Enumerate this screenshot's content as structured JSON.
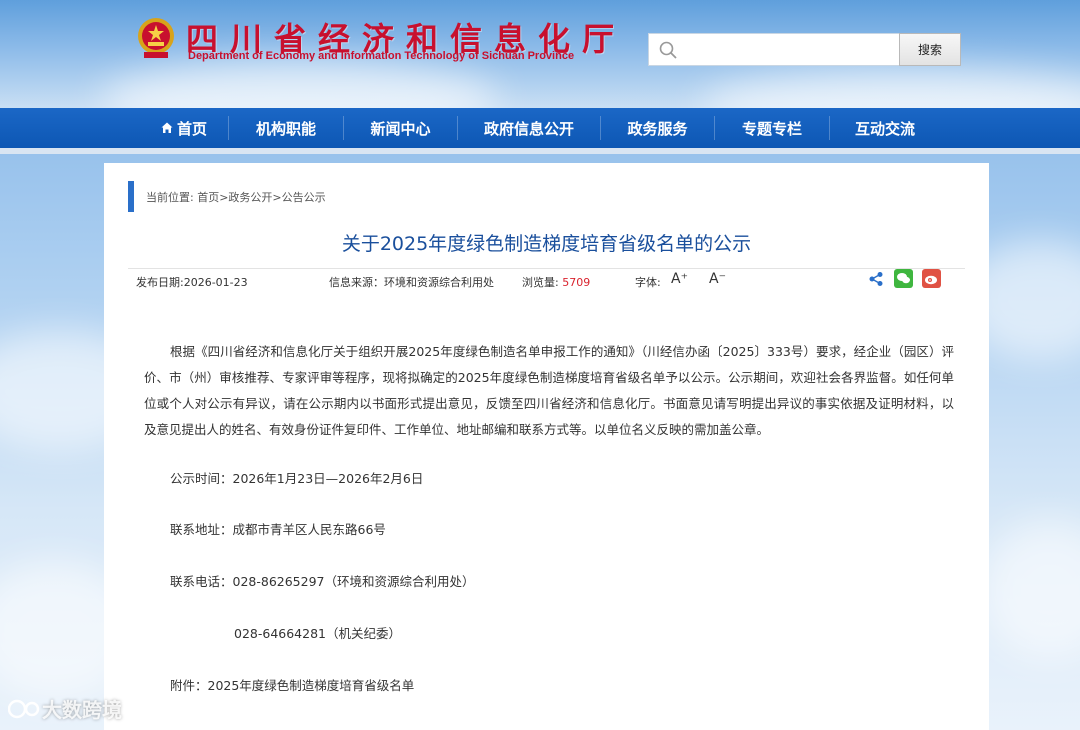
{
  "header": {
    "title": "四川省经济和信息化厅",
    "subtitle": "Department of Economy and Information Technology of Sichuan Province",
    "search_placeholder": "",
    "search_button": "搜索"
  },
  "nav": {
    "items": [
      {
        "label": "首页"
      },
      {
        "label": "机构职能"
      },
      {
        "label": "新闻中心"
      },
      {
        "label": "政府信息公开"
      },
      {
        "label": "政务服务"
      },
      {
        "label": "专题专栏"
      },
      {
        "label": "互动交流"
      }
    ]
  },
  "breadcrumb": "当前位置: 首页>政务公开>公告公示",
  "article": {
    "title": "关于2025年度绿色制造梯度培育省级名单的公示",
    "date_label": "发布日期:2026-01-23",
    "source_label": "信息来源：环境和资源综合利用处",
    "views_label": "浏览量: ",
    "views_value": "5709",
    "font_label": "字体:",
    "font_increase": "A⁺",
    "font_decrease": "A⁻",
    "body": "根据《四川省经济和信息化厅关于组织开展2025年度绿色制造名单申报工作的通知》（川经信办函〔2025〕333号）要求，经企业（园区）评价、市（州）审核推荐、专家评审等程序，现将拟确定的2025年度绿色制造梯度培育省级名单予以公示。公示期间，欢迎社会各界监督。如任何单位或个人对公示有异议，请在公示期内以书面形式提出意见，反馈至四川省经济和信息化厅。书面意见请写明提出异议的事实依据及证明材料，以及意见提出人的姓名、有效身份证件复印件、工作单位、地址邮编和联系方式等。以单位名义反映的需加盖公章。",
    "period": "公示时间：2026年1月23日—2026年2月6日",
    "address": "联系地址：成都市青羊区人民东路66号",
    "phone1": "联系电话：028-86265297（环境和资源综合利用处）",
    "phone2": "028-64664281（机关纪委）",
    "attachment": "附件：2025年度绿色制造梯度培育省级名单"
  },
  "watermark": "大数跨境",
  "colors": {
    "nav_bg": "#0d57b4",
    "title_red": "#c8102e",
    "article_title": "#1a4f9c",
    "views_red": "#d9232e"
  }
}
